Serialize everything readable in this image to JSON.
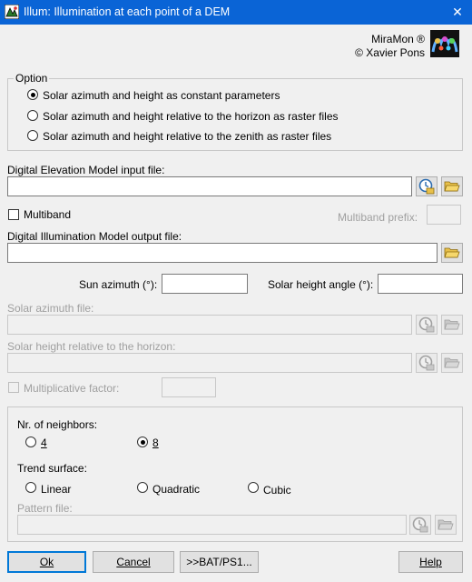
{
  "window": {
    "title": "Illum: Illumination at each point of a DEM",
    "close_glyph": "✕"
  },
  "brand": {
    "name": "MiraMon ®",
    "author": "© Xavier Pons"
  },
  "option": {
    "legend": "Option",
    "items": [
      {
        "label": "Solar azimuth and height as constant parameters",
        "selected": true
      },
      {
        "label": "Solar azimuth and height relative to the horizon as raster files",
        "selected": false
      },
      {
        "label": "Solar azimuth and height relative to the zenith as raster files",
        "selected": false
      }
    ]
  },
  "dem": {
    "label": "Digital Elevation Model input file:",
    "value": ""
  },
  "multiband": {
    "label": "Multiband",
    "checked": false,
    "prefix_label": "Multiband prefix:",
    "prefix_value": ""
  },
  "dim": {
    "label": "Digital Illumination Model output file:",
    "value": ""
  },
  "sun": {
    "azimuth_label": "Sun azimuth (°):",
    "azimuth_value": "",
    "height_label": "Solar height angle (°):",
    "height_value": ""
  },
  "solar_azimuth_file": {
    "label": "Solar azimuth file:",
    "value": ""
  },
  "solar_height_file": {
    "label": "Solar height relative to the horizon:",
    "value": ""
  },
  "multiplicative": {
    "label": "Multiplicative factor:",
    "value": ""
  },
  "neighbors": {
    "label": "Nr. of neighbors:",
    "options": [
      "4",
      "8"
    ],
    "selected": "8"
  },
  "trend": {
    "label": "Trend surface:",
    "options": [
      "Linear",
      "Quadratic",
      "Cubic"
    ]
  },
  "pattern": {
    "label": "Pattern file:",
    "value": ""
  },
  "buttons": {
    "ok": "Ok",
    "cancel": "Cancel",
    "bat": ">>BAT/PS1...",
    "help": "Help"
  },
  "icons": {
    "app": "miramon-app-icon",
    "logo": "miramon-logo-icon",
    "metadata": "metadata-clock-icon",
    "folder": "folder-open-icon"
  },
  "colors": {
    "titlebar": "#0a64d6",
    "window": "#f0f0f0",
    "disabled_text": "#a0a0a0",
    "folder": "#e8c04a"
  }
}
